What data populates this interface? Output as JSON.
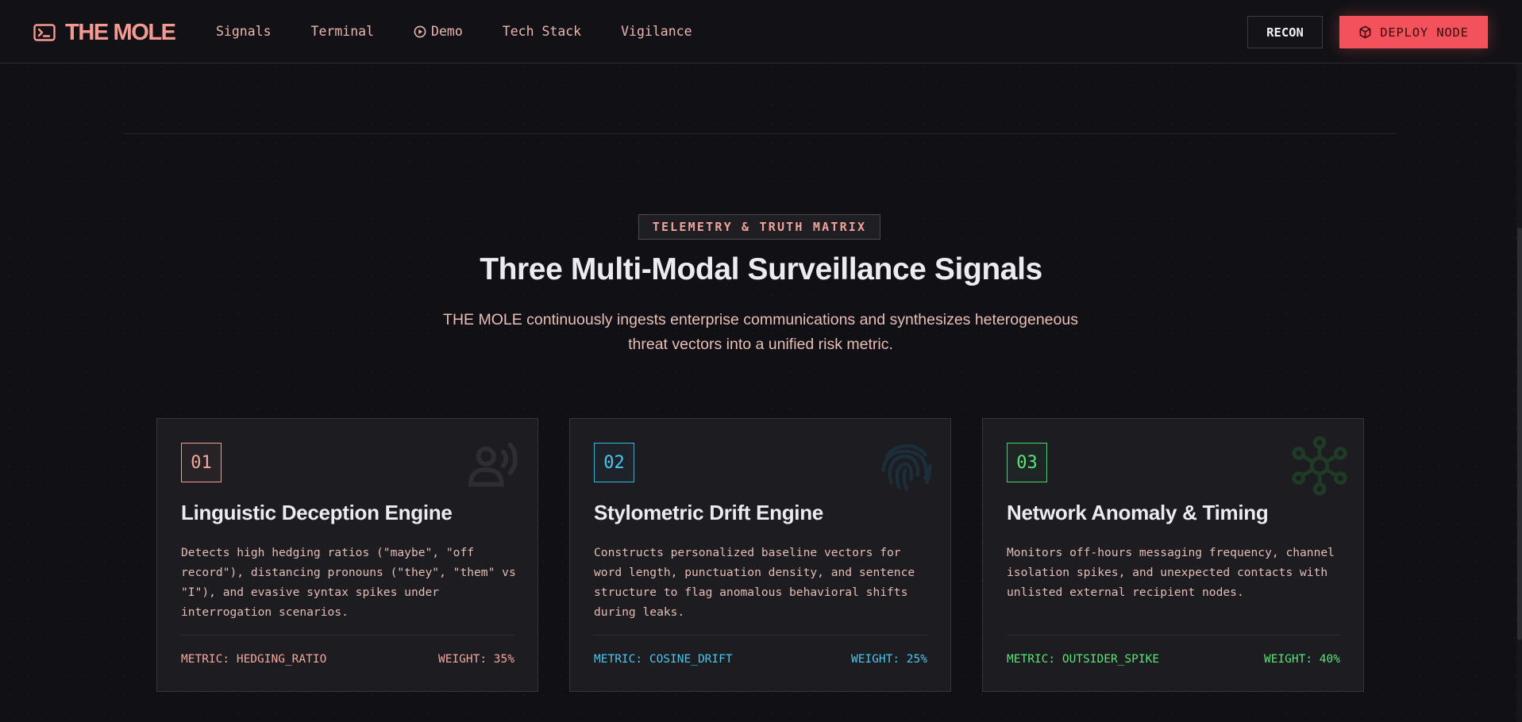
{
  "nav": {
    "brand": "THE MOLE",
    "links": [
      "Signals",
      "Terminal",
      "Demo",
      "Tech Stack",
      "Vigilance"
    ],
    "recon_label": "RECON",
    "deploy_label": "DEPLOY NODE"
  },
  "section": {
    "badge": "TELEMETRY & TRUTH MATRIX",
    "title": "Three Multi-Modal Surveillance Signals",
    "subtitle": "THE MOLE continuously ingests enterprise communications and synthesizes heterogeneous threat vectors into a unified risk metric."
  },
  "cards": [
    {
      "number": "01",
      "title": "Linguistic Deception Engine",
      "description": "Detects high hedging ratios (\"maybe\", \"off record\"), distancing pronouns (\"they\", \"them\" vs \"I\"), and evasive syntax spikes under interrogation scenarios.",
      "metric": "METRIC: HEDGING_RATIO",
      "weight": "WEIGHT: 35%",
      "icon": "voice-icon",
      "accent": "#f49a92"
    },
    {
      "number": "02",
      "title": "Stylometric Drift Engine",
      "description": "Constructs personalized baseline vectors for word length, punctuation density, and sentence structure to flag anomalous behavioral shifts during leaks.",
      "metric": "METRIC: COSINE_DRIFT",
      "weight": "WEIGHT: 25%",
      "icon": "fingerprint-icon",
      "accent": "#33b8e0"
    },
    {
      "number": "03",
      "title": "Network Anomaly & Timing",
      "description": "Monitors off-hours messaging frequency, channel isolation spikes, and unexpected contacts with unlisted external recipient nodes.",
      "metric": "METRIC: OUTSIDER_SPIKE",
      "weight": "WEIGHT: 40%",
      "icon": "network-hub-icon",
      "accent": "#48d862"
    }
  ],
  "colors": {
    "background": "#111115",
    "brand": "#f49a92",
    "deploy_button": "#f4525b"
  }
}
